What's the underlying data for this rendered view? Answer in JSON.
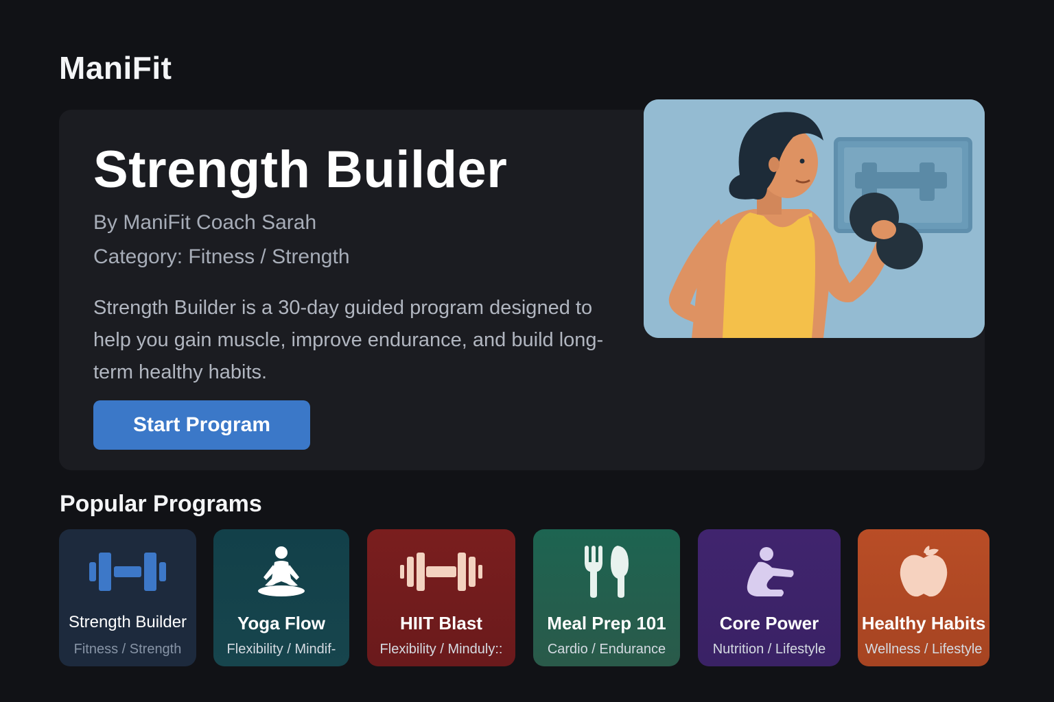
{
  "app": {
    "title": "ManiFit"
  },
  "hero": {
    "title": "Strength Builder",
    "author": "By ManiFit Coach Sarah",
    "category": "Category: Fitness / Strength",
    "description": "Strength Builder is a 30-day guided program designed to help you gain muscle, improve endurance, and build long-term healthy habits.",
    "cta_label": "Start Program",
    "illustration": "woman-lifting-dumbbell-illustration"
  },
  "popular": {
    "title": "Popular Programs",
    "cards": [
      {
        "name": "Strength Builder",
        "category": "Fitness / Strength",
        "icon": "dumbbell-icon",
        "color": "#1d2a3d"
      },
      {
        "name": "Yoga Flow",
        "category": "Flexibility / Mindif-",
        "icon": "meditation-icon",
        "color": "#124049"
      },
      {
        "name": "HIIT Blast",
        "category": "Flexibility / Minduly::",
        "icon": "barbell-icon",
        "color": "#7a1e1e"
      },
      {
        "name": "Meal Prep 101",
        "category": "Cardio / Endurance",
        "icon": "fork-spoon-icon",
        "color": "#1d6451"
      },
      {
        "name": "Core Power",
        "category": "Nutrition / Lifestyle",
        "icon": "stretching-person-icon",
        "color": "#40246e"
      },
      {
        "name": "Healthy Habits",
        "category": "Wellness / Lifestyle",
        "icon": "apple-icon",
        "color": "#b94d26"
      }
    ]
  },
  "colors": {
    "background": "#111216",
    "panel": "#1b1c21",
    "accent": "#3b78c8"
  }
}
